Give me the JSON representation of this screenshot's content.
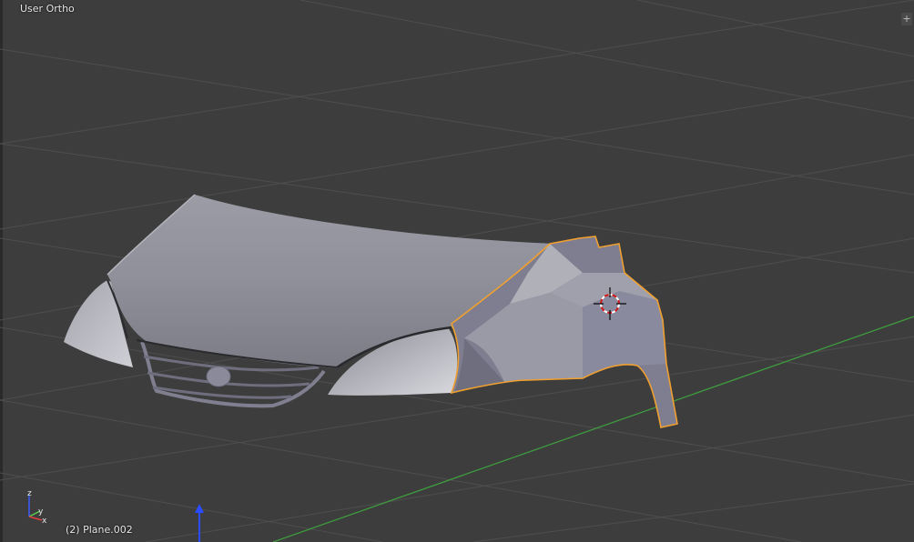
{
  "viewport": {
    "view_name": "User Ortho",
    "active_object": "(2) Plane.002",
    "background_color": "#3d3d3d",
    "grid_color": "#4e4e4e",
    "x_axis_color": "#3e9a3e",
    "z_axis_color": "#2a4bff",
    "selection_outline_color": "#f0a030",
    "mesh_color": "#9a9aa6"
  },
  "navigation": {
    "toggle_icon": "plus-icon",
    "toggle_glyph": "+"
  },
  "axes": {
    "x_label": "x",
    "y_label": "y",
    "z_label": "z"
  },
  "scene_objects": [
    {
      "name": "car-hood",
      "selected": false
    },
    {
      "name": "front-grille",
      "selected": false
    },
    {
      "name": "left-headlight",
      "selected": false
    },
    {
      "name": "right-headlight",
      "selected": false
    },
    {
      "name": "fender-panel",
      "selected": true
    }
  ]
}
